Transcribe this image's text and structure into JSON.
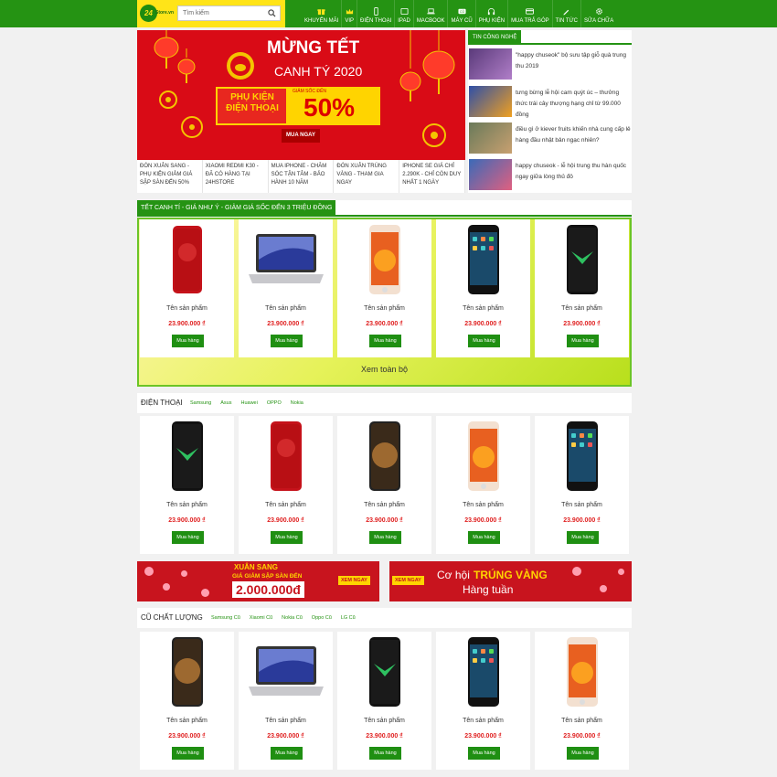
{
  "header": {
    "logo_badge": "24",
    "logo_text": "Store.vn",
    "search_placeholder": "Tìm kiếm",
    "nav": [
      "Khuyến mãi",
      "VIP",
      "Điện thoại",
      "iPad",
      "Macbook",
      "Máy cũ",
      "Phụ kiện",
      "Mua trả góp",
      "Tin tức",
      "Sửa chữa"
    ]
  },
  "hero": {
    "title1": "MỪNG TẾT",
    "title2": "CANH TÝ 2020",
    "product_line": "PHỤ KIỆN ĐIỆN THOẠI",
    "discount_label": "GIẢM SỐC ĐẾN",
    "discount": "50%",
    "cta": "MUA NGAY",
    "news": [
      "Đón xuân sang - phụ kiện giảm giá sập sàn đến 50%",
      "Xiaomi Redmi K30 - đã có hàng tại 24hStore",
      "Mua iPhone - Chăm sóc tận tâm - Bảo hành 10 năm",
      "Đón xuân trúng vàng - Tham gia ngay",
      "iPhone SE giá chỉ 2.290k - Chỉ còn duy nhất 1 ngày"
    ]
  },
  "tech_news": {
    "title": "Tin công nghệ",
    "items": [
      "\"happy chuseok\" bộ sưu tập giỗ quà trung thu 2019",
      "tưng bừng lễ hội cam quýt úc – thưởng thức trái cây thượng hạng chỉ từ 99.000 đồng",
      "điều gì ở kiever fruits khiến nhà cung cấp lẻ hàng đầu nhật bản ngạc nhiên?",
      "happy chuseok - lễ hội trung thu hàn quốc ngay giữa lòng thủ đô"
    ]
  },
  "promo": {
    "title": "TẾT CANH TÍ - GIÁ NHƯ Ý - GIẢM GIÁ SỐC ĐẾN 3 TRIỆU ĐỒNG",
    "see_all": "Xem toàn bộ",
    "products": [
      {
        "name": "Tên sản phẩm",
        "price": "23.900.000 ₫",
        "cta": "Mua hàng"
      },
      {
        "name": "Tên sản phẩm",
        "price": "23.900.000 ₫",
        "cta": "Mua hàng"
      },
      {
        "name": "Tên sản phẩm",
        "price": "23.900.000 ₫",
        "cta": "Mua hàng"
      },
      {
        "name": "Tên sản phẩm",
        "price": "23.900.000 ₫",
        "cta": "Mua hàng"
      },
      {
        "name": "Tên sản phẩm",
        "price": "23.900.000 ₫",
        "cta": "Mua hàng"
      }
    ]
  },
  "phones": {
    "title": "ĐIỆN THOẠI",
    "tags": [
      "Samsung",
      "Asus",
      "Huawei",
      "OPPO",
      "Nokia"
    ],
    "products": [
      {
        "name": "Tên sản phẩm",
        "price": "23.900.000 ₫",
        "cta": "Mua hàng"
      },
      {
        "name": "Tên sản phẩm",
        "price": "23.900.000 ₫",
        "cta": "Mua hàng"
      },
      {
        "name": "Tên sản phẩm",
        "price": "23.900.000 ₫",
        "cta": "Mua hàng"
      },
      {
        "name": "Tên sản phẩm",
        "price": "23.900.000 ₫",
        "cta": "Mua hàng"
      },
      {
        "name": "Tên sản phẩm",
        "price": "23.900.000 ₫",
        "cta": "Mua hàng"
      }
    ]
  },
  "banners": {
    "left_line1": "XUÂN SANG",
    "left_line2": "GIÁ GIẢM SẬP SÀN ĐẾN",
    "left_amount": "2.000.000đ",
    "left_cta": "XEM NGAY",
    "right_cta": "XEM NGAY",
    "right_line1a": "Cơ hội",
    "right_line1b": "TRÚNG VÀNG",
    "right_line2": "Hàng tuần"
  },
  "used": {
    "title": "CŨ CHẤT LƯỢNG",
    "tags": [
      "Samsung Cũ",
      "Xiaomi Cũ",
      "Nokia Cũ",
      "Oppo Cũ",
      "LG Cũ"
    ],
    "products": [
      {
        "name": "Tên sản phẩm",
        "price": "23.900.000 ₫",
        "cta": "Mua hàng"
      },
      {
        "name": "Tên sản phẩm",
        "price": "23.900.000 ₫",
        "cta": "Mua hàng"
      },
      {
        "name": "Tên sản phẩm",
        "price": "23.900.000 ₫",
        "cta": "Mua hàng"
      },
      {
        "name": "Tên sản phẩm",
        "price": "23.900.000 ₫",
        "cta": "Mua hàng"
      },
      {
        "name": "Tên sản phẩm",
        "price": "23.900.000 ₫",
        "cta": "Mua hàng"
      }
    ]
  },
  "colors": {
    "brand_green": "#259313",
    "logo_yellow": "#ffe418",
    "price_red": "#e02020",
    "banner_red": "#c8141e"
  }
}
